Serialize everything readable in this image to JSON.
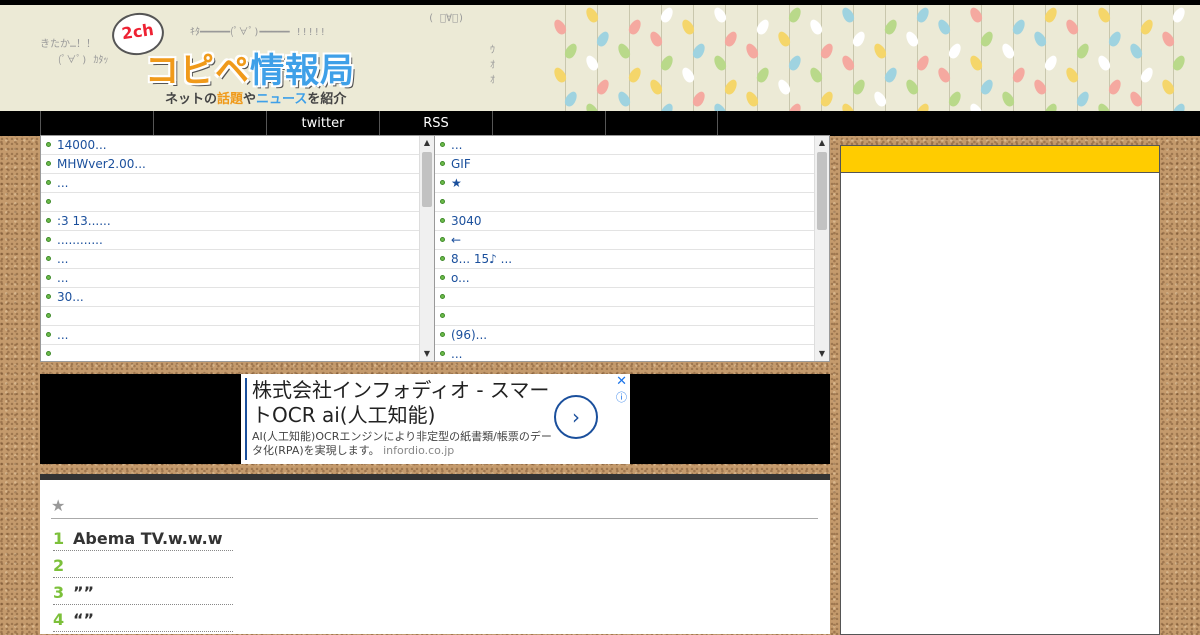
{
  "header": {
    "logo_badge": "2ch",
    "logo_title_part1": "コピペ",
    "logo_title_part2": "情報局",
    "logo_sub_1": "ネットの",
    "logo_sub_2": "話題",
    "logo_sub_3": "や",
    "logo_sub_4": "ニュース",
    "logo_sub_5": "を紹介",
    "aa_1": "きたか…！！",
    "aa_2": "(ﾟ∀ﾟ) ｶﾀｯ",
    "aa_3": "ｷﾀ━━━━━(ﾟ∀ﾟ)━━━━━ !!!!!",
    "aa_4": "( ﾟ∀ﾟ)",
    "aa_5": "ｳ\nｵ\nｵ"
  },
  "nav": {
    "items": [
      "",
      "",
      "twitter",
      "RSS",
      "",
      ""
    ]
  },
  "feed_left": {
    "items": [
      "14000...",
      "MHWver2.00...",
      "...",
      "",
      ":3 13......",
      "............",
      "...",
      "...",
      "30...",
      "",
      "...",
      ""
    ]
  },
  "feed_right": {
    "items": [
      "...",
      "GIF",
      "★",
      "",
      "3040",
      "←",
      "8... 15♪ ...",
      "o...",
      "",
      "",
      "(96)...",
      "..."
    ]
  },
  "ad": {
    "title": "株式会社インフォディオ - スマートOCR ai(人工知能)",
    "description": "AI(人工知能)OCRエンジンにより非定型の紙書類/帳票のデータ化(RPA)を実現します。",
    "domain": "infordio.co.jp",
    "arrow": "›",
    "close": "✕",
    "info": "ⓘ"
  },
  "article": {
    "star": "★",
    "ranking": [
      {
        "num": "1",
        "text": "Abema TV.w.w.w"
      },
      {
        "num": "2",
        "text": ""
      },
      {
        "num": "3",
        "text": "””"
      },
      {
        "num": "4",
        "text": "“”"
      }
    ]
  },
  "sidebar": {
    "header": ""
  },
  "colors": {
    "nav_bg": "#000000",
    "link": "#1a4f9c",
    "bullet": "#6dbb4a",
    "rank_number": "#7cc03a",
    "sidebar_header": "#ffcc00",
    "cork": "#c49a6c"
  },
  "icons": [
    "feed-bullet-icon",
    "scroll-up-arrow-icon",
    "scroll-down-arrow-icon",
    "ad-arrow-icon",
    "ad-close-icon",
    "ad-info-icon"
  ]
}
